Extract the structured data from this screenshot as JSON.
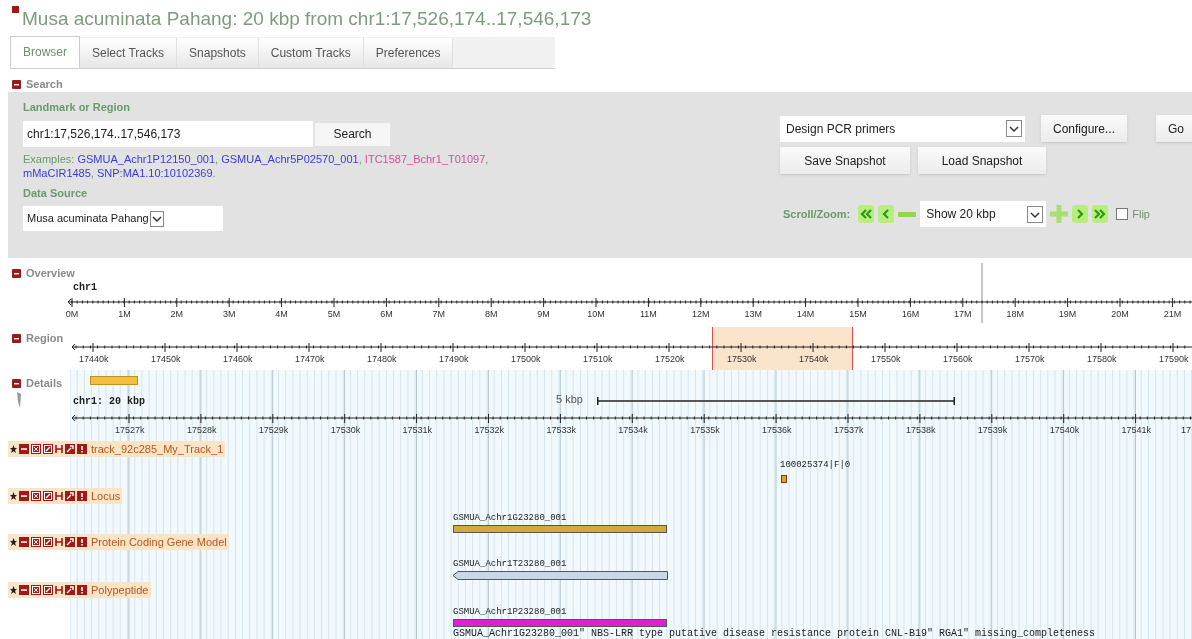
{
  "title": "Musa acuminata Pahang: 20 kbp from chr1:17,526,174..17,546,173",
  "tabs": [
    {
      "label": "Browser",
      "selected": true
    },
    {
      "label": "Select Tracks",
      "selected": false
    },
    {
      "label": "Snapshots",
      "selected": false
    },
    {
      "label": "Custom Tracks",
      "selected": false
    },
    {
      "label": "Preferences",
      "selected": false
    }
  ],
  "search": {
    "header": {
      "label": "Search",
      "expanded": true
    },
    "landmark_label": "Landmark or Region",
    "landmark_value": "chr1:17,526,174..17,546,173",
    "search_button": "Search",
    "examples_label": "Examples:",
    "examples": [
      {
        "text": "GSMUA_Achr1P12150_001",
        "color": "#3b3bdc",
        "suffix": ","
      },
      {
        "text": "GSMUA_Achr5P02570_001",
        "color": "#3b3bdc",
        "suffix": ","
      },
      {
        "text": "ITC1587_Bchr1_T01097",
        "color": "#d0509a",
        "suffix": ","
      },
      {
        "text": "mMaCIR1485",
        "color": "#3b3bdc",
        "suffix": ","
      },
      {
        "text": "SNP:MA1.10:10102369",
        "color": "#3b3bdc",
        "suffix": "."
      }
    ],
    "data_source_label": "Data Source",
    "data_source": "Musa acuminata Pahang",
    "action_select": "Design PCR primers",
    "configure_button": "Configure...",
    "go_button": "Go",
    "save_snapshot": "Save Snapshot",
    "load_snapshot": "Load Snapshot",
    "scroll_zoom_label": "Scroll/Zoom:",
    "zoom_select": "Show 20 kbp",
    "flip": {
      "label": "Flip",
      "checked": false
    }
  },
  "overview": {
    "header": {
      "label": "Overview",
      "expanded": true
    },
    "chromosome": "chr1",
    "ticks": [
      "0M",
      "1M",
      "2M",
      "3M",
      "4M",
      "5M",
      "6M",
      "7M",
      "8M",
      "9M",
      "10M",
      "11M",
      "12M",
      "13M",
      "14M",
      "15M",
      "16M",
      "17M",
      "18M",
      "19M",
      "20M",
      "21M"
    ]
  },
  "region": {
    "header": {
      "label": "Region",
      "expanded": true
    },
    "ticks": [
      "17440k",
      "17450k",
      "17460k",
      "17470k",
      "17480k",
      "17490k",
      "17500k",
      "17510k",
      "17520k",
      "17530k",
      "17540k",
      "17550k",
      "17560k",
      "17570k",
      "17580k",
      "17590k"
    ]
  },
  "details": {
    "header": {
      "label": "Details",
      "expanded": true
    },
    "title": "chr1: 20 kbp",
    "scale_label": "5 kbp",
    "ticks": [
      "17527k",
      "17528k",
      "17529k",
      "17530k",
      "17531k",
      "17532k",
      "17533k",
      "17534k",
      "17535k",
      "17536k",
      "17537k",
      "17538k",
      "17539k",
      "17540k",
      "17541k",
      "17"
    ],
    "tracks": [
      {
        "label": "track_92c285_My_Track_1",
        "features": [
          {
            "kind": "marker",
            "label": "100025374|F|0",
            "color": "#e0a030"
          }
        ]
      },
      {
        "label": "Locus",
        "features": [
          {
            "kind": "box",
            "label": "GSMUA_Achr1G23280_001",
            "color": "#d4aa3a"
          }
        ]
      },
      {
        "label": "Protein Coding Gene Model",
        "features": [
          {
            "kind": "arrow_left",
            "label": "GSMUA_Achr1T23280_001",
            "color": "#c8d8e4"
          }
        ]
      },
      {
        "label": "Polypeptide",
        "features": [
          {
            "kind": "box",
            "label": "GSMUA_Achr1P23280_001",
            "color": "#e020d0",
            "description": "GSMUA_Achr1G23280_001\" NBS-LRR type putative disease resistance protein CNL-B19\" RGA1\" missing_completeness"
          }
        ]
      }
    ]
  }
}
